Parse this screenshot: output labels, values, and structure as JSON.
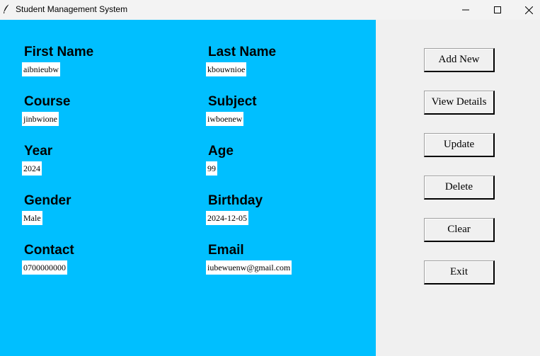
{
  "window": {
    "title": "Student Management System",
    "icons": [
      "feather-icon",
      "minimize-icon",
      "maximize-icon",
      "close-icon"
    ]
  },
  "form": {
    "panel_color": "#00bfff",
    "fields": {
      "first_name": {
        "label": "First Name",
        "value": "aibnieubw"
      },
      "last_name": {
        "label": "Last Name",
        "value": "kbouwnioe"
      },
      "course": {
        "label": "Course",
        "value": "jinbwione"
      },
      "subject": {
        "label": "Subject",
        "value": "iwboenew"
      },
      "year": {
        "label": "Year",
        "value": "2024"
      },
      "age": {
        "label": "Age",
        "value": "99"
      },
      "gender": {
        "label": "Gender",
        "value": "Male"
      },
      "birthday": {
        "label": "Birthday",
        "value": "2024-12-05"
      },
      "contact": {
        "label": "Contact",
        "value": "0700000000"
      },
      "email": {
        "label": "Email",
        "value": "iubewuenw@gmail.com"
      }
    }
  },
  "actions": {
    "add_new": "Add New",
    "view_details": "View Details",
    "update": "Update",
    "delete": "Delete",
    "clear": "Clear",
    "exit": "Exit"
  }
}
